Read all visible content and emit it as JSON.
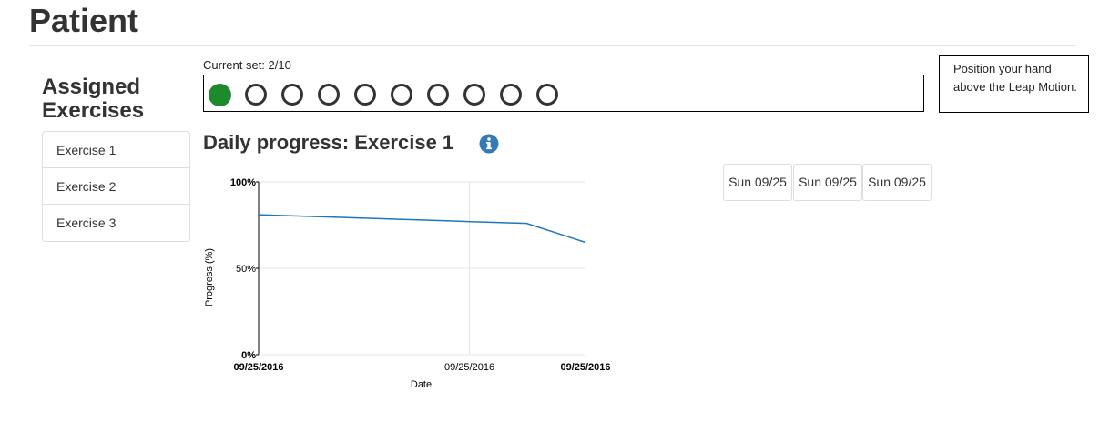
{
  "header": {
    "title": "Patient"
  },
  "sidebar": {
    "title": "Assigned Exercises",
    "items": [
      {
        "label": "Exercise 1"
      },
      {
        "label": "Exercise 2"
      },
      {
        "label": "Exercise 3"
      }
    ]
  },
  "sets": {
    "label": "Current set: 2/10",
    "total": 10,
    "completed": 1,
    "completed_color": "#1e8a2e"
  },
  "instruction": {
    "text": "Position your hand above the Leap Motion."
  },
  "progress": {
    "title": "Daily progress: Exercise 1",
    "info_icon": "info-circle-icon",
    "accent": "#337ab7"
  },
  "date_buttons": [
    "Sun 09/25",
    "Sun 09/25",
    "Sun 09/25"
  ],
  "chart_data": {
    "type": "line",
    "xlabel": "Date",
    "ylabel": "Progress (%)",
    "ylim": [
      0,
      100
    ],
    "y_ticks": [
      "0%",
      "50%",
      "100%"
    ],
    "x_ticks": [
      "09/25/2016",
      "09/25/2016",
      "09/25/2016"
    ],
    "grid": true,
    "series": [
      {
        "color": "#1f77b4",
        "x": [
          0,
          0.65,
          0.82,
          1.0
        ],
        "y": [
          81,
          77,
          76,
          65
        ]
      }
    ]
  }
}
